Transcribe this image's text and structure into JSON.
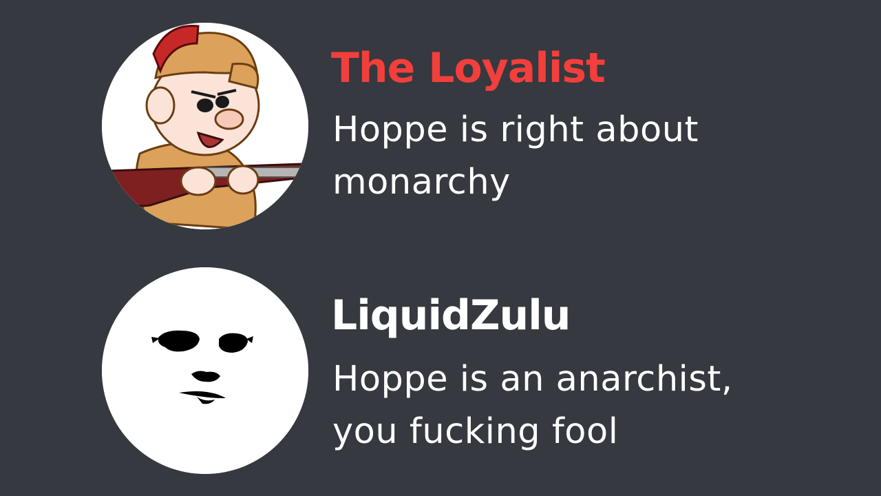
{
  "messages": [
    {
      "username": "The Loyalist",
      "username_color": "#f23f3c",
      "avatar": "elmer-fudd-hunter-avatar",
      "text_line1": "Hoppe is right about",
      "text_line2": "monarchy"
    },
    {
      "username": "LiquidZulu",
      "username_color": "#ffffff",
      "avatar": "minimal-face-avatar",
      "text_line1": "Hoppe is an anarchist,",
      "text_line2": "you fucking fool"
    }
  ],
  "colors": {
    "background": "#36393f",
    "message_text": "#ffffff"
  }
}
